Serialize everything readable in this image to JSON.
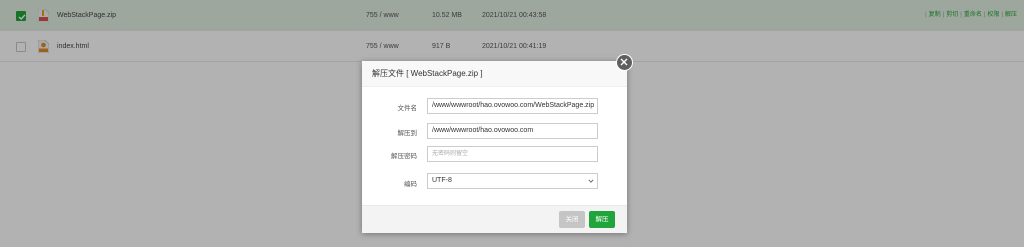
{
  "files": [
    {
      "name": "WebStackPage.zip",
      "permission": "755 / www",
      "size": "10.52 MB",
      "modified": "2021/10/21 00:43:58",
      "checked": true,
      "icon": "zip-file-icon"
    },
    {
      "name": "index.html",
      "permission": "755 / www",
      "size": "917 B",
      "modified": "2021/10/21 00:41:19",
      "checked": false,
      "icon": "html-file-icon"
    }
  ],
  "row_ops": [
    "复制",
    "剪切",
    "重命名",
    "权限",
    "解压"
  ],
  "dialog": {
    "title": "解压文件 [ WebStackPage.zip ]",
    "filename_label": "文件名",
    "filename_value": "/www/wwwroot/hao.ovowoo.com/WebStackPage.zip",
    "extract_to_label": "解压到",
    "extract_to_value": "/www/wwwroot/hao.ovowoo.com",
    "password_label": "解压密码",
    "password_placeholder": "无密码则留空",
    "encoding_label": "编码",
    "encoding_value": "UTF-8",
    "cancel_label": "关闭",
    "confirm_label": "解压"
  },
  "colors": {
    "accent": "#20a53a",
    "selected_row": "#e3efe3",
    "overlay": "rgba(0,0,0,0.3)"
  }
}
